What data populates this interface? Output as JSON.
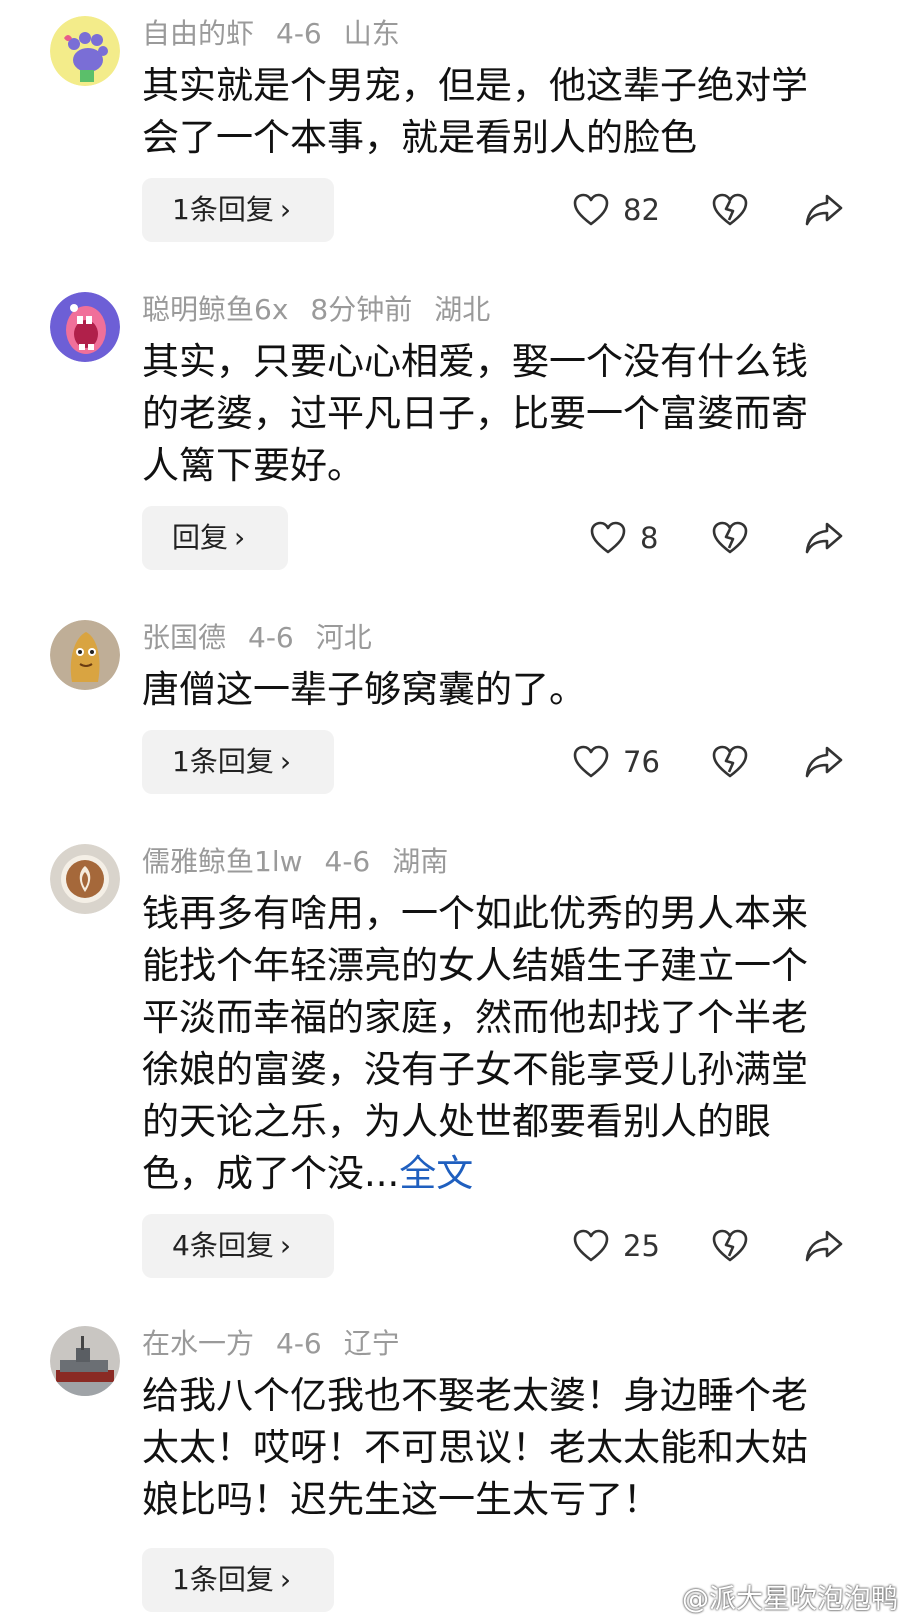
{
  "comments": [
    {
      "username": "自由的虾",
      "time": "4-6",
      "location": "山东",
      "lines": [
        "其实就是个男宠，但是，他这辈子绝对学",
        "会了一个本事，就是看别人的脸色"
      ],
      "reply_label": "1条回复",
      "likes": "82",
      "avatar_icon": "paw-avatar-icon"
    },
    {
      "username": "聪明鲸鱼6x",
      "time": "8分钟前",
      "location": "湖北",
      "lines": [
        "其实，只要心心相爱，娶一个没有什么钱",
        "的老婆，过平凡日子，比要一个富婆而寄",
        "人篱下要好。"
      ],
      "reply_label": "回复",
      "likes": "8",
      "avatar_icon": "monster-avatar-icon"
    },
    {
      "username": "张国德",
      "time": "4-6",
      "location": "河北",
      "lines": [
        "唐僧这一辈子够窝囊的了。"
      ],
      "reply_label": "1条回复",
      "likes": "76",
      "avatar_icon": "cartoon-avatar-icon"
    },
    {
      "username": "儒雅鲸鱼1lw",
      "time": "4-6",
      "location": "湖南",
      "lines": [
        "钱再多有啥用，一个如此优秀的男人本来",
        "能找个年轻漂亮的女人结婚生子建立一个",
        "平淡而幸福的家庭，然而他却找了个半老",
        "徐娘的富婆，没有子女不能享受儿孙满堂",
        "的天论之乐，为人处世都要看别人的眼"
      ],
      "last_line": "色，成了个没...",
      "more_label": "全文",
      "reply_label": "4条回复",
      "likes": "25",
      "avatar_icon": "latte-avatar-icon"
    },
    {
      "username": "在水一方",
      "time": "4-6",
      "location": "辽宁",
      "lines": [
        "给我八个亿我也不娶老太婆！身边睡个老",
        "太太！哎呀！不可思议！老太太能和大姑",
        "娘比吗！迟先生这一生太亏了！"
      ],
      "reply_label": "1条回复",
      "avatar_icon": "ship-avatar-icon"
    }
  ],
  "watermark": "@派大星吹泡泡鸭",
  "colors": {
    "meta_text": "#9a9a9a",
    "link": "#1f5fbf",
    "reply_bg": "#f2f2f2"
  },
  "icons": [
    "heart-icon",
    "broken-heart-icon",
    "share-icon",
    "chevron-right-icon"
  ]
}
